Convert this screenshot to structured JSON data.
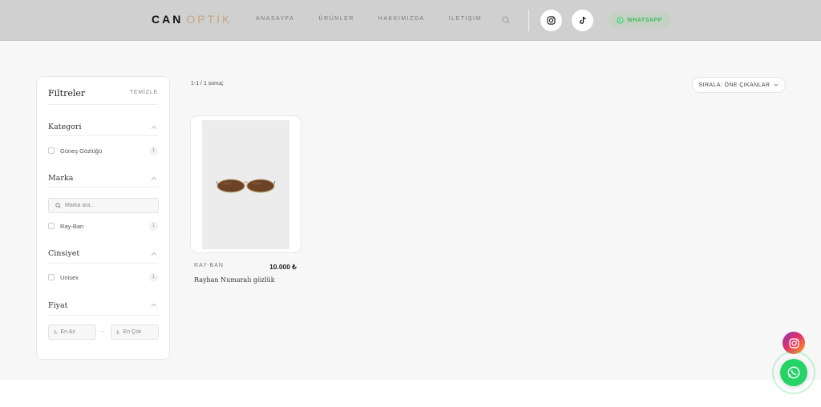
{
  "header": {
    "logo_main": "CAN",
    "logo_accent": "OPTİK",
    "nav": [
      "ANASAYFA",
      "ÜRÜNLER",
      "HAKKIMIZDA",
      "İLETİŞİM"
    ],
    "whatsapp_label": "WHATSAPP",
    "colors": {
      "header_bg": "#d0d0d0",
      "accent": "#c8a47e",
      "whatsapp": "#25d366"
    }
  },
  "filters": {
    "title": "Filtreler",
    "clear": "TEMİZLE",
    "category": {
      "title": "Kategori",
      "options": [
        {
          "label": "Güneş Gözlüğü",
          "count": "1"
        }
      ]
    },
    "brand": {
      "title": "Marka",
      "search_placeholder": "Marka ara...",
      "options": [
        {
          "label": "Ray-Ban",
          "count": "1"
        }
      ]
    },
    "gender": {
      "title": "Cinsiyet",
      "options": [
        {
          "label": "Unisex",
          "count": "1"
        }
      ]
    },
    "price": {
      "title": "Fiyat",
      "currency": "₺",
      "min_placeholder": "En Az",
      "max_placeholder": "En Çok",
      "separator": "–"
    }
  },
  "results": {
    "count_text": "1-1 / 1 sonuç",
    "sort_label": "SIRALA: ÖNE ÇIKANLAR"
  },
  "products": [
    {
      "brand": "RAY-BAN",
      "price": "10.000 ₺",
      "name": "Rayban Numaralı gözlük"
    }
  ]
}
